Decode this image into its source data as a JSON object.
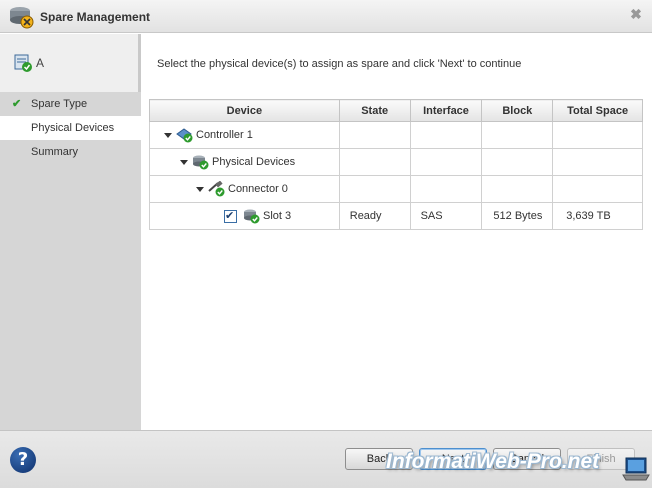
{
  "window": {
    "title": "Spare Management",
    "close_glyph": "✖"
  },
  "sidebar": {
    "server_label": "A",
    "steps": [
      {
        "label": "Spare Type",
        "done": true
      },
      {
        "label": "Physical Devices",
        "active": true
      },
      {
        "label": "Summary"
      }
    ],
    "check_glyph": "✔"
  },
  "main": {
    "instruction": "Select the physical device(s) to assign as spare and click 'Next' to continue",
    "table": {
      "columns": [
        "Device",
        "State",
        "Interface",
        "Block",
        "Total Space"
      ],
      "rows": [
        {
          "device": "Controller 1",
          "state": "",
          "interface": "",
          "block": "",
          "total_space": ""
        },
        {
          "device": "Physical Devices",
          "state": "",
          "interface": "",
          "block": "",
          "total_space": ""
        },
        {
          "device": "Connector 0",
          "state": "",
          "interface": "",
          "block": "",
          "total_space": ""
        },
        {
          "device": "Slot 3",
          "state": "Ready",
          "interface": "SAS",
          "block": "512 Bytes",
          "total_space": "3,639 TB",
          "checked": true
        }
      ]
    }
  },
  "footer": {
    "help_glyph": "?",
    "back_label": "Back",
    "next_label": "Next",
    "cancel_label": "Cancel",
    "finish_label": "Finish"
  },
  "watermark": {
    "text": "InformatiWeb-Pro.net"
  },
  "colors": {
    "accent_check": "#2e9b2e",
    "primary_border": "#4d8fce",
    "help_blue": "#0d2f6b"
  }
}
